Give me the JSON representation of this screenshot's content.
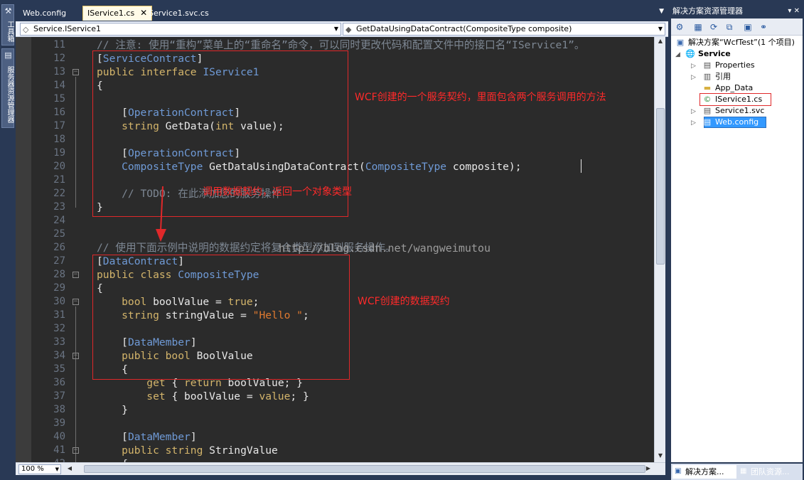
{
  "left_strip": {
    "tabs": [
      {
        "label": "工具箱",
        "icon": "toolbox-icon"
      },
      {
        "label": "服务器资源管理器",
        "icon": "server-explorer-icon"
      }
    ]
  },
  "doc_tabs": [
    {
      "label": "Web.config",
      "active": false
    },
    {
      "label": "IService1.cs",
      "active": true,
      "close": "✕"
    },
    {
      "label": "Service1.svc.cs",
      "active": false
    }
  ],
  "nav": {
    "left_combo": "Service.IService1",
    "right_combo": "GetDataUsingDataContract(CompositeType composite)"
  },
  "lines": [
    {
      "n": "11",
      "tokens": [
        [
          "cmt",
          "// 注意: 使用“重构”菜单上的“重命名”命令，可以同时更改代码和配置文件中的接口名“IService1”。"
        ]
      ]
    },
    {
      "n": "12",
      "tokens": [
        [
          "txt",
          "["
        ],
        [
          "attr",
          "ServiceContract"
        ],
        [
          "txt",
          "]"
        ]
      ]
    },
    {
      "n": "13",
      "tokens": [
        [
          "kw",
          "public interface "
        ],
        [
          "type",
          "IService1"
        ]
      ]
    },
    {
      "n": "14",
      "tokens": [
        [
          "txt",
          "{"
        ]
      ]
    },
    {
      "n": "15",
      "tokens": []
    },
    {
      "n": "16",
      "tokens": [
        [
          "txt",
          "    ["
        ],
        [
          "attr",
          "OperationContract"
        ],
        [
          "txt",
          "]"
        ]
      ]
    },
    {
      "n": "17",
      "tokens": [
        [
          "kw",
          "    string "
        ],
        [
          "txt",
          "GetData("
        ],
        [
          "kw",
          "int"
        ],
        [
          "txt",
          " value);"
        ]
      ]
    },
    {
      "n": "18",
      "tokens": []
    },
    {
      "n": "19",
      "tokens": [
        [
          "txt",
          "    ["
        ],
        [
          "attr",
          "OperationContract"
        ],
        [
          "txt",
          "]"
        ]
      ]
    },
    {
      "n": "20",
      "tokens": [
        [
          "type",
          "    CompositeType"
        ],
        [
          "txt",
          " GetDataUsingDataContract("
        ],
        [
          "type",
          "CompositeType"
        ],
        [
          "txt",
          " composite);"
        ]
      ]
    },
    {
      "n": "21",
      "tokens": []
    },
    {
      "n": "22",
      "tokens": [
        [
          "cmt",
          "    // TODO: 在此添加您的服务操作"
        ]
      ]
    },
    {
      "n": "23",
      "tokens": [
        [
          "txt",
          "}"
        ]
      ]
    },
    {
      "n": "24",
      "tokens": []
    },
    {
      "n": "25",
      "tokens": []
    },
    {
      "n": "26",
      "tokens": [
        [
          "cmt",
          "// 使用下面示例中说明的数据约定将复合类型添加到服务操作。"
        ]
      ]
    },
    {
      "n": "27",
      "tokens": [
        [
          "txt",
          "["
        ],
        [
          "attr",
          "DataContract"
        ],
        [
          "txt",
          "]"
        ]
      ]
    },
    {
      "n": "28",
      "tokens": [
        [
          "kw",
          "public class "
        ],
        [
          "type",
          "CompositeType"
        ]
      ]
    },
    {
      "n": "29",
      "tokens": [
        [
          "txt",
          "{"
        ]
      ]
    },
    {
      "n": "30",
      "tokens": [
        [
          "kw",
          "    bool "
        ],
        [
          "txt",
          "boolValue = "
        ],
        [
          "kw",
          "true"
        ],
        [
          "txt",
          ";"
        ]
      ]
    },
    {
      "n": "31",
      "tokens": [
        [
          "kw",
          "    string "
        ],
        [
          "txt",
          "stringValue = "
        ],
        [
          "str",
          "\"Hello \""
        ],
        [
          "txt",
          ";"
        ]
      ]
    },
    {
      "n": "32",
      "tokens": []
    },
    {
      "n": "33",
      "tokens": [
        [
          "txt",
          "    ["
        ],
        [
          "attr",
          "DataMember"
        ],
        [
          "txt",
          "]"
        ]
      ]
    },
    {
      "n": "34",
      "tokens": [
        [
          "kw",
          "    public bool "
        ],
        [
          "txt",
          "BoolValue"
        ]
      ]
    },
    {
      "n": "35",
      "tokens": [
        [
          "txt",
          "    {"
        ]
      ]
    },
    {
      "n": "36",
      "tokens": [
        [
          "kw",
          "        get "
        ],
        [
          "txt",
          "{ "
        ],
        [
          "kw",
          "return "
        ],
        [
          "txt",
          "boolValue; }"
        ]
      ]
    },
    {
      "n": "37",
      "tokens": [
        [
          "kw",
          "        set "
        ],
        [
          "txt",
          "{ boolValue = "
        ],
        [
          "kw",
          "value"
        ],
        [
          "txt",
          "; }"
        ]
      ]
    },
    {
      "n": "38",
      "tokens": [
        [
          "txt",
          "    }"
        ]
      ]
    },
    {
      "n": "39",
      "tokens": []
    },
    {
      "n": "40",
      "tokens": [
        [
          "txt",
          "    ["
        ],
        [
          "attr",
          "DataMember"
        ],
        [
          "txt",
          "]"
        ]
      ]
    },
    {
      "n": "41",
      "tokens": [
        [
          "kw",
          "    public string "
        ],
        [
          "txt",
          "StringValue"
        ]
      ]
    },
    {
      "n": "42",
      "tokens": [
        [
          "txt",
          "    {"
        ]
      ]
    }
  ],
  "annotations": {
    "service_contract": "WCF创建的一个服务契约，里面包含两个服务调用的方法",
    "call_data": "调用数据契约，返回一个对象类型",
    "data_contract": "WCF创建的数据契约"
  },
  "watermark": "http://blog.csdn.net/wangweimutou",
  "zoom": "100 %",
  "solution_explorer": {
    "title": "解决方案资源管理器",
    "title_buttons": "▾ ✕",
    "solution": "解决方案“WcfTest”(1 个项目)",
    "project": "Service",
    "items": [
      "Properties",
      "引用",
      "App_Data",
      "IService1.cs",
      "Service1.svc",
      "Web.config"
    ],
    "bottom_tabs": [
      "解决方案...",
      "团队资源..."
    ]
  }
}
